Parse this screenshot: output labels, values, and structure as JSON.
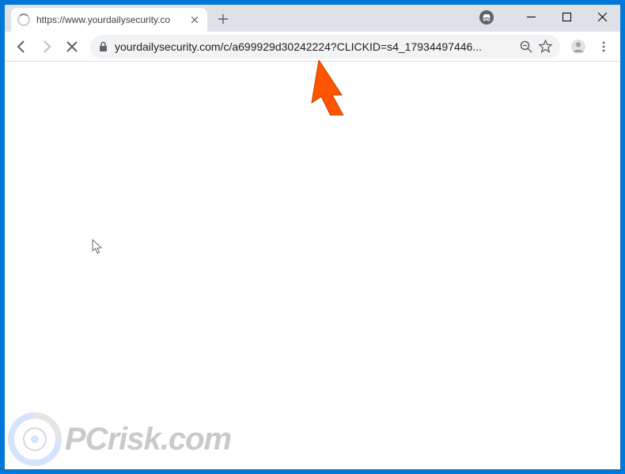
{
  "tab": {
    "title": "https://www.yourdailysecurity.co"
  },
  "address": {
    "url": "yourdailysecurity.com/c/a699929d30242224?CLICKID=s4_17934497446..."
  },
  "watermark": {
    "text": "PCrisk.com"
  }
}
